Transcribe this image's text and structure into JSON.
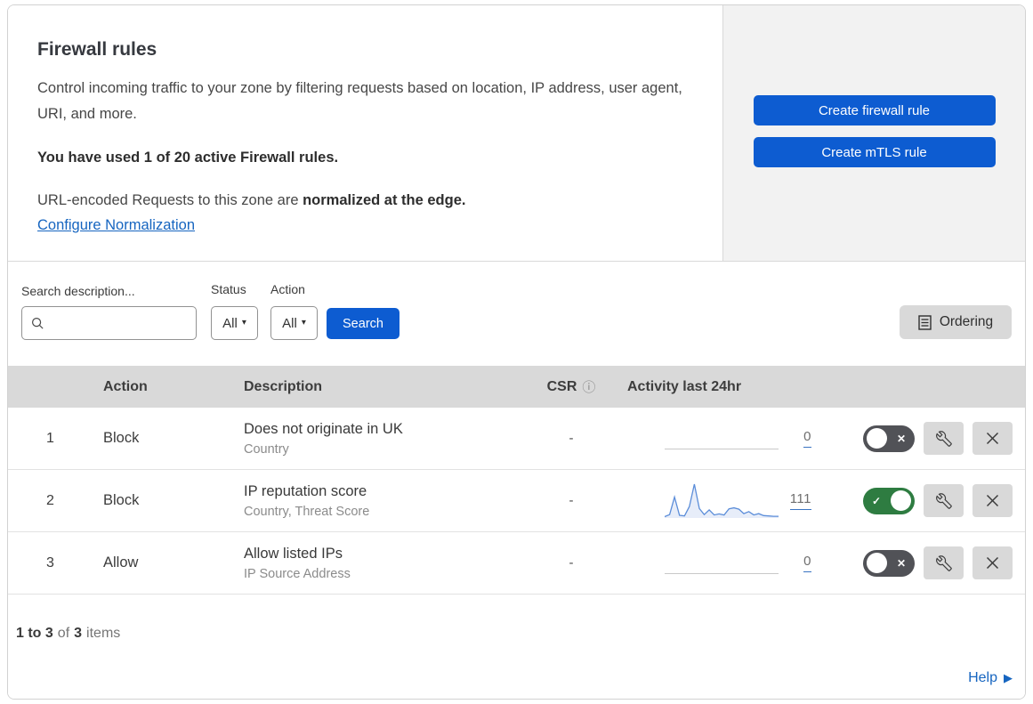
{
  "header": {
    "title": "Firewall rules",
    "description": "Control incoming traffic to your zone by filtering requests based on location, IP address, user agent, URI, and more.",
    "usage": "You have used 1 of 20 active Firewall rules.",
    "normalization_text": "URL-encoded Requests to this zone are ",
    "normalization_bold": "normalized at the edge.",
    "normalization_link": "Configure Normalization",
    "create_firewall_button": "Create firewall rule",
    "create_mtls_button": "Create mTLS rule"
  },
  "filters": {
    "search_label": "Search description...",
    "search_value": "",
    "status_label": "Status",
    "status_value": "All",
    "action_label": "Action",
    "action_value": "All",
    "search_button": "Search",
    "ordering_button": "Ordering"
  },
  "table": {
    "headers": {
      "action": "Action",
      "description": "Description",
      "csr": "CSR",
      "activity": "Activity last 24hr"
    },
    "rows": [
      {
        "priority": "1",
        "action": "Block",
        "description": "Does not originate in UK",
        "fields": "Country",
        "csr": "-",
        "count": "0",
        "enabled": false
      },
      {
        "priority": "2",
        "action": "Block",
        "description": "IP reputation score",
        "fields": "Country, Threat Score",
        "csr": "-",
        "count": "111",
        "enabled": true
      },
      {
        "priority": "3",
        "action": "Allow",
        "description": "Allow listed IPs",
        "fields": "IP Source Address",
        "csr": "-",
        "count": "0",
        "enabled": false
      }
    ],
    "sparkline_values": [
      4,
      10,
      62,
      8,
      6,
      34,
      100,
      28,
      10,
      24,
      9,
      12,
      9,
      27,
      30,
      26,
      13,
      19,
      9,
      13,
      7,
      6,
      5,
      5
    ]
  },
  "footer": {
    "range": "1 to 3",
    "of": "of",
    "total": "3",
    "items": "items",
    "help": "Help"
  },
  "icons": {
    "caret_down": "▾",
    "toggle_off": "✕",
    "toggle_on": "✓",
    "info": "ⓘ",
    "help_arrow": "▶"
  },
  "colors": {
    "primary_blue": "#0d5cd1",
    "link_blue": "#1665c0",
    "toggle_on_green": "#2e7c41",
    "toggle_off_gray": "#515257",
    "table_header_bg": "#d9d9d9",
    "panel_bg": "#f2f2f2",
    "sparkline_line": "#5b8dd9",
    "sparkline_fill": "#e7edf9"
  }
}
